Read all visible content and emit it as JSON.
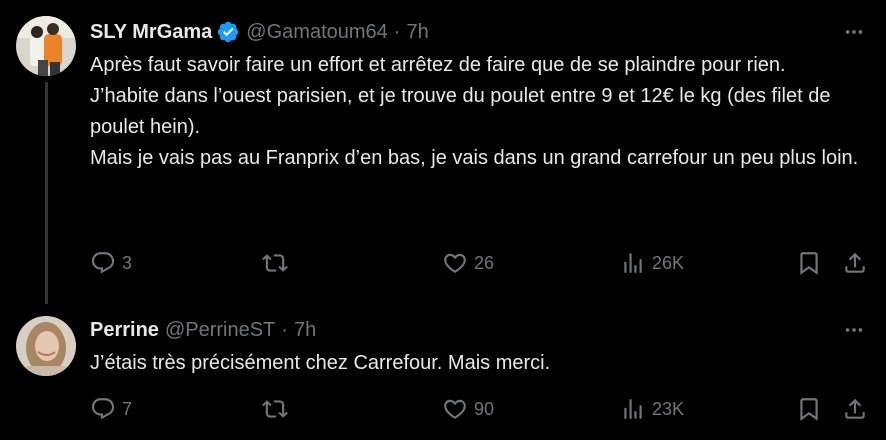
{
  "tweets": [
    {
      "author_name": "SLY MrGama",
      "handle": "@Gamatoum64",
      "separator": "·",
      "time": "7h",
      "verified": true,
      "lines": [
        "Après faut savoir faire un effort et arrêtez de faire que de se plaindre pour rien.",
        "J’habite dans l’ouest parisien, et je trouve du poulet entre 9 et 12€ le kg (des filet de poulet hein).",
        "Mais je vais pas au Franprix d’en bas, je vais dans un grand carrefour un peu plus loin."
      ],
      "replies": "3",
      "retweets": "",
      "likes": "26",
      "views": "26K"
    },
    {
      "author_name": "Perrine",
      "handle": "@PerrineST",
      "separator": "·",
      "time": "7h",
      "verified": false,
      "lines": [
        "J’étais très précisément chez Carrefour. Mais merci."
      ],
      "replies": "7",
      "retweets": "",
      "likes": "90",
      "views": "23K"
    }
  ],
  "colors": {
    "background": "#000000",
    "text": "#e7e9ea",
    "muted": "#71767b",
    "verified": "#1d9bf0",
    "thread_line": "#333639"
  },
  "icons": [
    "more-icon",
    "verified-badge-icon",
    "reply-icon",
    "retweet-icon",
    "like-icon",
    "views-icon",
    "bookmark-icon",
    "share-icon"
  ]
}
